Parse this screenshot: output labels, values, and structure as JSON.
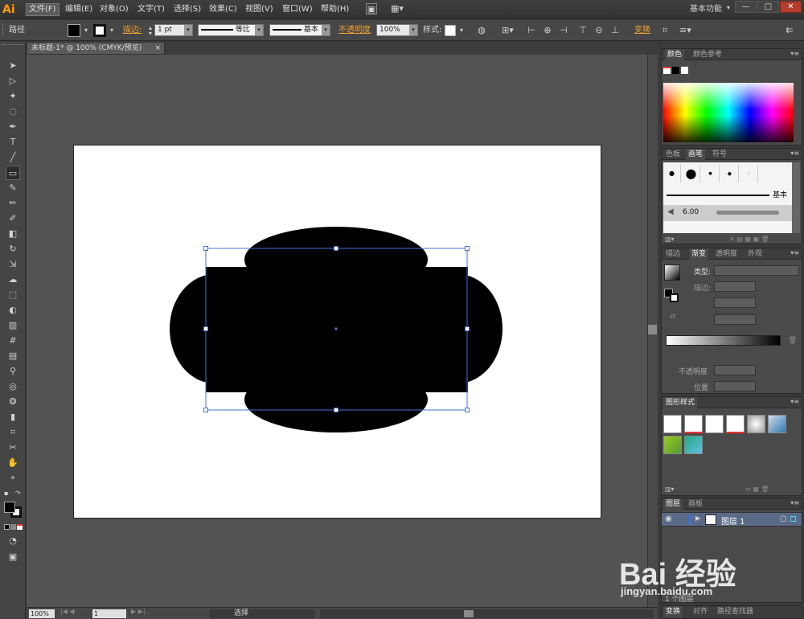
{
  "app": {
    "logo": "Ai"
  },
  "menu": [
    {
      "label": "文件(F)",
      "active": true
    },
    {
      "label": "编辑(E)"
    },
    {
      "label": "对象(O)"
    },
    {
      "label": "文字(T)"
    },
    {
      "label": "选择(S)"
    },
    {
      "label": "效果(C)"
    },
    {
      "label": "视图(V)"
    },
    {
      "label": "窗口(W)"
    },
    {
      "label": "帮助(H)"
    }
  ],
  "workspace": "基本功能",
  "window_buttons": {
    "minimize": "—",
    "restore": "□",
    "close": "✕"
  },
  "control_bar": {
    "object_type": "路径",
    "stroke_link": "描边:",
    "stroke_weight": "1 pt",
    "stroke_profile": "等比",
    "brush_def": "基本",
    "opacity_link": "不透明度",
    "opacity_value": "100%",
    "style_label": "样式:",
    "transform_link": "变换"
  },
  "document": {
    "tab_title": "未标题-1* @ 100% (CMYK/预览)",
    "close": "×"
  },
  "statusbar": {
    "zoom": "100%",
    "artboard_index": "1",
    "tool_status": "选择"
  },
  "tools": [
    "selection-tool",
    "direct-selection-tool",
    "magic-wand-tool",
    "lasso-tool",
    "pen-tool",
    "type-tool",
    "line-tool",
    "rectangle-tool",
    "paintbrush-tool",
    "pencil-tool",
    "blob-brush-tool",
    "eraser-tool",
    "rotate-tool",
    "scale-tool",
    "warp-tool",
    "free-transform-tool",
    "shape-builder-tool",
    "perspective-grid-tool",
    "mesh-tool",
    "gradient-tool",
    "eyedropper-tool",
    "blend-tool",
    "symbol-sprayer-tool",
    "column-graph-tool",
    "artboard-tool",
    "slice-tool",
    "hand-tool",
    "zoom-tool"
  ],
  "panels": {
    "color": {
      "tabs": [
        "颜色",
        "颜色参考"
      ]
    },
    "brushes": {
      "tabs": [
        "色板",
        "画笔",
        "符号"
      ],
      "basic_label": "基本",
      "brush_size": "6.00"
    },
    "gradient": {
      "tabs": [
        "描边",
        "渐变",
        "透明度",
        "外观"
      ],
      "type_label": "类型:",
      "stroke_label": "描边:",
      "opacity_label": "不透明度",
      "location_label": "位置"
    },
    "graphic_styles": {
      "tabs": [
        "图形样式"
      ]
    },
    "layers": {
      "tabs": [
        "图层",
        "画板"
      ],
      "layer_name": "图层 1",
      "count_label": "1 个图层"
    },
    "bottom_tabs": [
      "变换",
      "对齐",
      "路径查找器"
    ]
  },
  "colors": {
    "selection_blue": "#4a6fd6",
    "accent_orange": "#f0a030"
  },
  "watermark": {
    "logo": "Bai 经验",
    "url": "jingyan.baidu.com"
  }
}
